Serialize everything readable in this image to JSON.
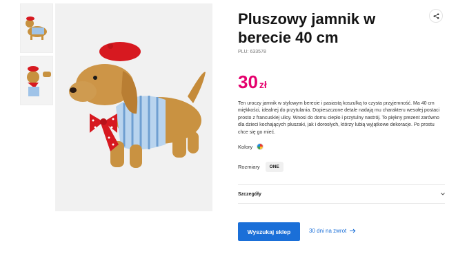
{
  "product": {
    "title": "Pluszowy jamnik w berecie 40 cm",
    "plu": "PLU: 633578",
    "price": {
      "amount": "30",
      "currency": "zł"
    },
    "description": "Ten uroczy jamnik w stylowym berecie i pasiastą koszulką to czysta przyjemność. Ma 40 cm miękkości, idealnej do przytulania. Dopieszczone detale nadają mu charakteru wesołej postaci prosto z francuskiej ulicy. Wnosi do domu ciepło i przytulny nastrój. To piękny prezent zarówno dla dzieci kochających pluszaki, jak i dorosłych, którzy lubią wyjątkowe dekoracje. Po prostu chce się go mieć.",
    "colors_label": "Kolory",
    "sizes_label": "Rozmiary",
    "size_value": "ONE",
    "details_label": "Szczegóły"
  },
  "actions": {
    "find_store": "Wyszukaj sklep",
    "returns": "30 dni na zwrot"
  },
  "icons": {
    "share": "share-icon",
    "chevron": "chevron-down-icon",
    "arrow": "arrow-right-icon",
    "color": "multicolor-swatch-icon"
  },
  "colors": {
    "price": "#e5006d",
    "accent": "#1a6fd8"
  }
}
